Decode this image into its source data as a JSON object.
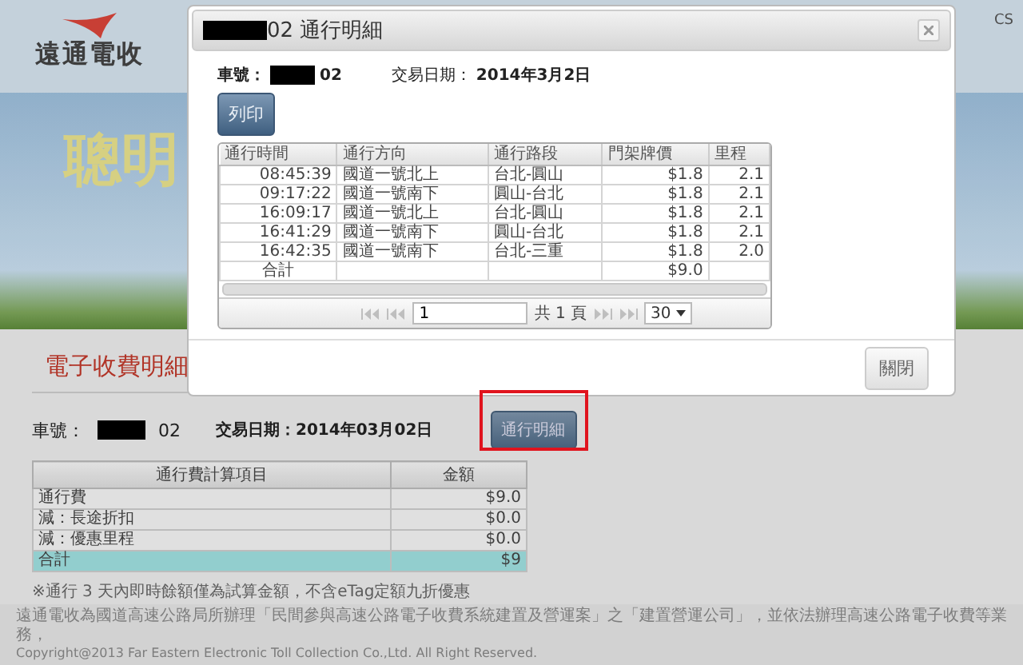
{
  "header": {
    "logo_text": "遠通電收",
    "corner_text": "CS"
  },
  "banner": {
    "headline": "聰明"
  },
  "page": {
    "section_title": "電子收費明細",
    "plate_label": "車號：",
    "plate_suffix": "02",
    "date_text": "交易日期：2014年03月02日",
    "details_button": "通行明細",
    "fee_table": {
      "columns": [
        "通行費計算項目",
        "金額"
      ],
      "rows": [
        {
          "kind": "normal",
          "item": "通行費",
          "amount": "$9.0"
        },
        {
          "kind": "normal",
          "item": "減：長途折扣",
          "amount": "$0.0"
        },
        {
          "kind": "normal",
          "item": "減：優惠里程",
          "amount": "$0.0"
        },
        {
          "kind": "total",
          "item": "合計",
          "amount": "$9"
        }
      ]
    },
    "note": "※通行 3 天內即時餘額僅為試算金額，不含eTag定額九折優惠"
  },
  "footer": {
    "lines": [
      "遠通電收為國道高速公路局所辦理「民間參與高速公路電子收費系統建置及營運案」之「建置營運公司」，並依法辦理高速公路電子收費等業務，",
      "Copyright@2013 Far Eastern Electronic Toll Collection Co.,Ltd. All Right Reserved."
    ]
  },
  "dialog": {
    "title_suffix": "02 通行明細",
    "plate_label": "車號：",
    "plate_suffix": "02",
    "date_label": "交易日期：",
    "date_value": "2014年3月2日",
    "print_button": "列印",
    "table": {
      "columns": [
        "通行時間",
        "通行方向",
        "通行路段",
        "門架牌價",
        "里程"
      ],
      "rows": [
        {
          "time": "08:45:39",
          "direction": "國道一號北上",
          "route": "台北-圓山",
          "fare": "$1.8",
          "distance": "2.1"
        },
        {
          "time": "09:17:22",
          "direction": "國道一號南下",
          "route": "圓山-台北",
          "fare": "$1.8",
          "distance": "2.1"
        },
        {
          "time": "16:09:17",
          "direction": "國道一號北上",
          "route": "台北-圓山",
          "fare": "$1.8",
          "distance": "2.1"
        },
        {
          "time": "16:41:29",
          "direction": "國道一號南下",
          "route": "圓山-台北",
          "fare": "$1.8",
          "distance": "2.1"
        },
        {
          "time": "16:42:35",
          "direction": "國道一號南下",
          "route": "台北-三重",
          "fare": "$1.8",
          "distance": "2.0"
        }
      ],
      "total": {
        "label": "合計",
        "fare": "$9.0"
      }
    },
    "pager": {
      "page_input": "1",
      "page_total": "共 1 頁",
      "page_size": "30"
    },
    "close_button": "關閉"
  }
}
